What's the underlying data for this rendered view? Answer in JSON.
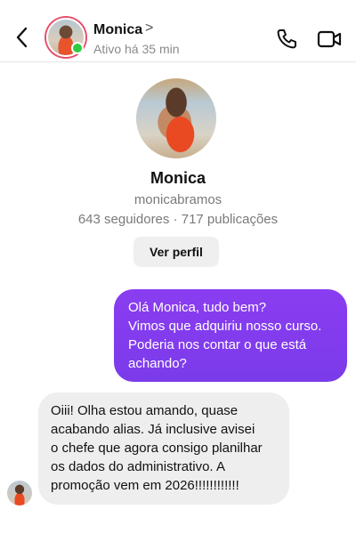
{
  "header": {
    "name": "Monica",
    "chevron": ">",
    "status": "Ativo há 35 min",
    "icons": {
      "back": "chevron-left-icon",
      "call": "phone-icon",
      "video": "video-camera-icon"
    }
  },
  "profile": {
    "name": "Monica",
    "handle": "monicabramos",
    "stats": "643 seguidores · 717 publicações",
    "view_button": "Ver perfil"
  },
  "messages": [
    {
      "direction": "outgoing",
      "lines": [
        "Olá Monica, tudo bem?",
        "Vimos que adquiriu nosso curso.",
        "Poderia nos contar o que está",
        "achando?"
      ]
    },
    {
      "direction": "incoming",
      "lines": [
        "Oiii! Olha estou amando, quase",
        "acabando alias. Já inclusive avisei",
        "o chefe que agora consigo planilhar",
        "os dados do administrativo. A",
        "promoção vem em 2026!!!!!!!!!!!!"
      ]
    }
  ],
  "colors": {
    "outgoing_bubble": "#7b3bea",
    "incoming_bubble": "#eeeeef",
    "online_dot": "#2ecc40"
  }
}
